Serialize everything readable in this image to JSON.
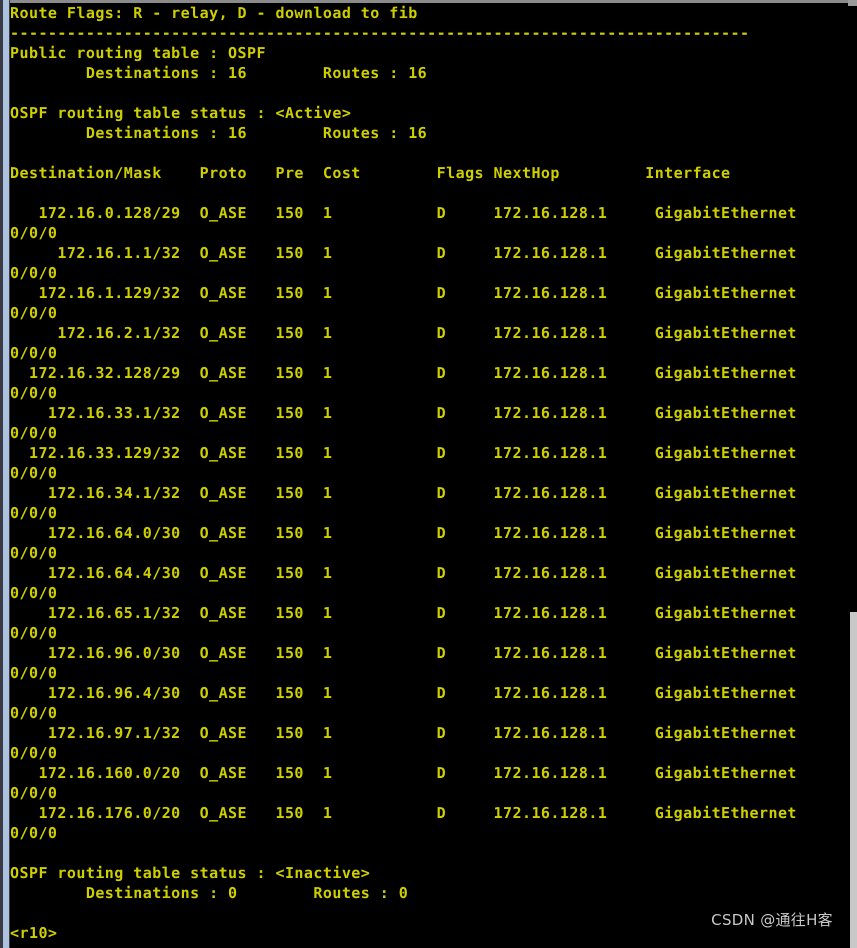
{
  "terminal": {
    "prompt": "<r10>",
    "route_flags_legend": "Route Flags: R - relay, D - download to fib",
    "separator": "------------------------------------------------------------------------------",
    "public_table_label": "Public routing table : OSPF",
    "public_table_counts": "        Destinations : 16        Routes : 16",
    "active_status_label": "OSPF routing table status : <Active>",
    "active_status_counts": "        Destinations : 16        Routes : 16",
    "inactive_status_label": "OSPF routing table status : <Inactive>",
    "inactive_status_counts": "        Destinations : 0        Routes : 0",
    "columns": {
      "destination_mask": "Destination/Mask",
      "proto": "Proto",
      "pre": "Pre",
      "cost": "Cost",
      "flags": "Flags",
      "nexthop": "NextHop",
      "interface": "Interface"
    },
    "header_line": "Destination/Mask    Proto   Pre  Cost        Flags NextHop         Interface",
    "routes": [
      {
        "destination": "172.16.0.128/29",
        "proto": "O_ASE",
        "pre": "150",
        "cost": "1",
        "flags": "D",
        "nexthop": "172.16.128.1",
        "interface": "GigabitEthernet",
        "interface_wrap": "0/0/0"
      },
      {
        "destination": "172.16.1.1/32",
        "proto": "O_ASE",
        "pre": "150",
        "cost": "1",
        "flags": "D",
        "nexthop": "172.16.128.1",
        "interface": "GigabitEthernet",
        "interface_wrap": "0/0/0"
      },
      {
        "destination": "172.16.1.129/32",
        "proto": "O_ASE",
        "pre": "150",
        "cost": "1",
        "flags": "D",
        "nexthop": "172.16.128.1",
        "interface": "GigabitEthernet",
        "interface_wrap": "0/0/0"
      },
      {
        "destination": "172.16.2.1/32",
        "proto": "O_ASE",
        "pre": "150",
        "cost": "1",
        "flags": "D",
        "nexthop": "172.16.128.1",
        "interface": "GigabitEthernet",
        "interface_wrap": "0/0/0"
      },
      {
        "destination": "172.16.32.128/29",
        "proto": "O_ASE",
        "pre": "150",
        "cost": "1",
        "flags": "D",
        "nexthop": "172.16.128.1",
        "interface": "GigabitEthernet",
        "interface_wrap": "0/0/0"
      },
      {
        "destination": "172.16.33.1/32",
        "proto": "O_ASE",
        "pre": "150",
        "cost": "1",
        "flags": "D",
        "nexthop": "172.16.128.1",
        "interface": "GigabitEthernet",
        "interface_wrap": "0/0/0"
      },
      {
        "destination": "172.16.33.129/32",
        "proto": "O_ASE",
        "pre": "150",
        "cost": "1",
        "flags": "D",
        "nexthop": "172.16.128.1",
        "interface": "GigabitEthernet",
        "interface_wrap": "0/0/0"
      },
      {
        "destination": "172.16.34.1/32",
        "proto": "O_ASE",
        "pre": "150",
        "cost": "1",
        "flags": "D",
        "nexthop": "172.16.128.1",
        "interface": "GigabitEthernet",
        "interface_wrap": "0/0/0"
      },
      {
        "destination": "172.16.64.0/30",
        "proto": "O_ASE",
        "pre": "150",
        "cost": "1",
        "flags": "D",
        "nexthop": "172.16.128.1",
        "interface": "GigabitEthernet",
        "interface_wrap": "0/0/0"
      },
      {
        "destination": "172.16.64.4/30",
        "proto": "O_ASE",
        "pre": "150",
        "cost": "1",
        "flags": "D",
        "nexthop": "172.16.128.1",
        "interface": "GigabitEthernet",
        "interface_wrap": "0/0/0"
      },
      {
        "destination": "172.16.65.1/32",
        "proto": "O_ASE",
        "pre": "150",
        "cost": "1",
        "flags": "D",
        "nexthop": "172.16.128.1",
        "interface": "GigabitEthernet",
        "interface_wrap": "0/0/0"
      },
      {
        "destination": "172.16.96.0/30",
        "proto": "O_ASE",
        "pre": "150",
        "cost": "1",
        "flags": "D",
        "nexthop": "172.16.128.1",
        "interface": "GigabitEthernet",
        "interface_wrap": "0/0/0"
      },
      {
        "destination": "172.16.96.4/30",
        "proto": "O_ASE",
        "pre": "150",
        "cost": "1",
        "flags": "D",
        "nexthop": "172.16.128.1",
        "interface": "GigabitEthernet",
        "interface_wrap": "0/0/0"
      },
      {
        "destination": "172.16.97.1/32",
        "proto": "O_ASE",
        "pre": "150",
        "cost": "1",
        "flags": "D",
        "nexthop": "172.16.128.1",
        "interface": "GigabitEthernet",
        "interface_wrap": "0/0/0"
      },
      {
        "destination": "172.16.160.0/20",
        "proto": "O_ASE",
        "pre": "150",
        "cost": "1",
        "flags": "D",
        "nexthop": "172.16.128.1",
        "interface": "GigabitEthernet",
        "interface_wrap": "0/0/0"
      },
      {
        "destination": "172.16.176.0/20",
        "proto": "O_ASE",
        "pre": "150",
        "cost": "1",
        "flags": "D",
        "nexthop": "172.16.128.1",
        "interface": "GigabitEthernet",
        "interface_wrap": "0/0/0"
      }
    ],
    "colors": {
      "background": "#000000",
      "text": "#cfcf00",
      "scrollbar_thumb": "#adc2de",
      "watermark": "#c9c9c9"
    }
  },
  "watermark": {
    "text": "CSDN @通往H客"
  }
}
